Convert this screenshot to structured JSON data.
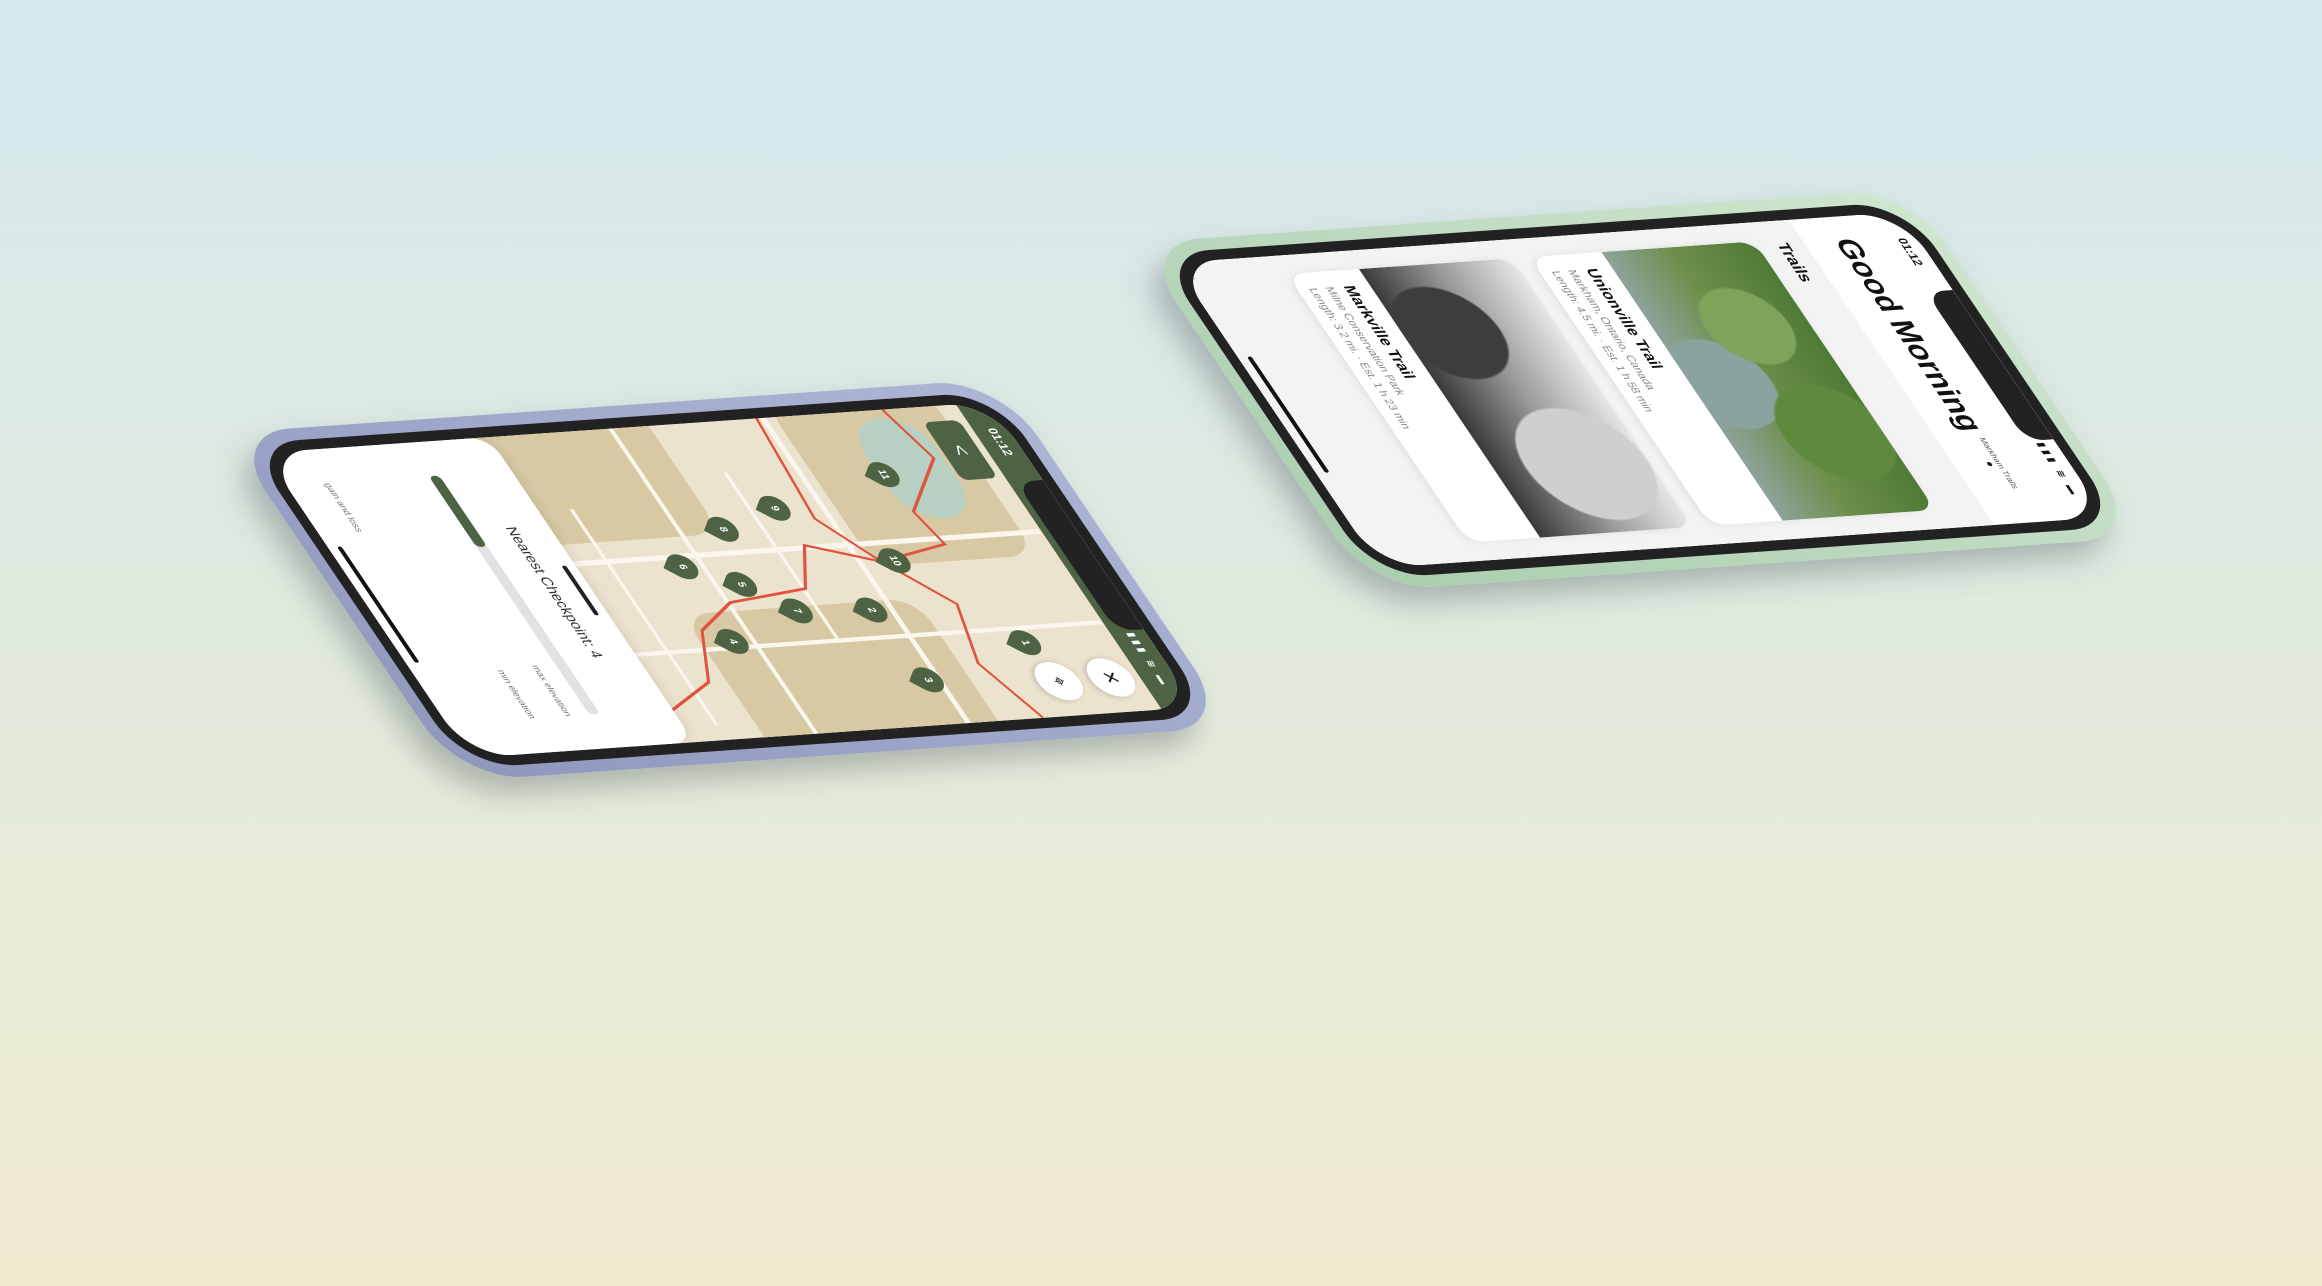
{
  "map_screen": {
    "status_time": "01:12",
    "status_icons": "▮▮▮ ≋ ▬",
    "back_label": "<",
    "close_label": "✕",
    "locate_label": "⌖",
    "checkpoints": [
      "1",
      "2",
      "3",
      "4",
      "5",
      "6",
      "7",
      "8",
      "9",
      "10",
      "11"
    ],
    "nearest_checkpoint": "Nearest Checkpoint: 4",
    "progress_fraction": 0.3,
    "max_elevation_label": "max elevation",
    "min_elevation_label": "min elevation",
    "gain_loss_label": "gain and loss"
  },
  "home_screen": {
    "status_time": "01:12",
    "status_icons": "▮▮▮ ≋ ▬",
    "greeting": "Good Morning",
    "subtab_label": "Markham Trails",
    "section_title": "Trails",
    "trails": [
      {
        "name": "Unionville Trail",
        "location": "Markham, Ontario, Canada",
        "details": "Length: 4.5 mi. · Est. 1 h 58 min"
      },
      {
        "name": "Markville Trail",
        "location": "Milne Conservation Park",
        "details": "Length: 3.2 mi. · Est. 1 h 23 min"
      }
    ]
  },
  "colors": {
    "accent_green": "#4d6343",
    "route_red": "#e0533f",
    "map_base": "#ece3cf"
  }
}
